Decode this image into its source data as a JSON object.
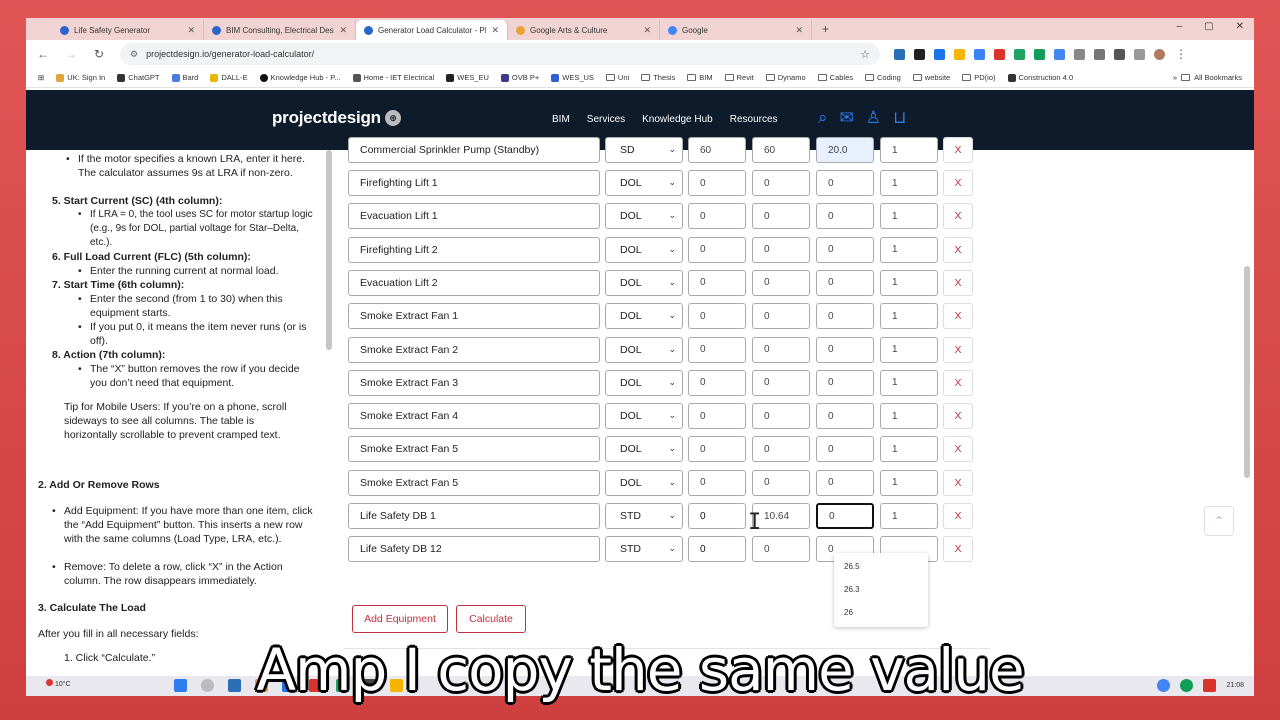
{
  "browser": {
    "tabs": [
      {
        "label": "Life Safety Generator",
        "active": false
      },
      {
        "label": "BIM Consulting, Electrical Des",
        "active": false
      },
      {
        "label": "Generator Load Calculator - PL",
        "active": true
      },
      {
        "label": "Google Arts & Culture",
        "active": false
      },
      {
        "label": "Google",
        "active": false
      }
    ],
    "new_tab": "+",
    "window_controls": [
      "–",
      "▢",
      "✕"
    ],
    "url": "projectdesign.io/generator-load-calculator/",
    "bookmarks": [
      "UK: Sign In",
      "ChatGPT",
      "Bard",
      "DALL-E",
      "Knowledge Hub - P...",
      "Home - IET Electrical",
      "WES_EU",
      "OVB P+",
      "WES_US",
      "Uni",
      "Thesis",
      "BIM",
      "Revit",
      "Dynamo",
      "Cables",
      "Coding",
      "website",
      "PD(io)",
      "Construction 4.0"
    ],
    "all_bookmarks": "All Bookmarks"
  },
  "site": {
    "logo": "projectdesign",
    "nav": [
      "BIM",
      "Services",
      "Knowledge Hub",
      "Resources"
    ],
    "icons": [
      "search-icon",
      "mail-icon",
      "user-icon",
      "cart-icon"
    ]
  },
  "left_panel": {
    "b1": "If the motor specifies a known LRA, enter it here. The calculator assumes 9s at LRA if non-zero.",
    "h5": "5. Start Current (SC) (4th column):",
    "b5": "If LRA = 0, the tool uses SC for motor startup logic (e.g., 9s for DOL, partial voltage for Star–Delta, etc.).",
    "h6": "6. Full Load Current (FLC) (5th column):",
    "b6": "Enter the running current at normal load.",
    "h7": "7. Start Time (6th column):",
    "b7a": "Enter the second (from 1 to 30) when this equipment starts.",
    "b7b": "If you put 0, it means the item never runs (or is off).",
    "h8": "8. Action (7th column):",
    "b8": "The “X” button removes the row if you decide you don’t need that equipment.",
    "tip": "Tip for Mobile Users: If you’re on a phone, scroll sideways to see all columns. The table is horizontally scrollable to prevent cramped text.",
    "h_add": "2. Add Or Remove Rows",
    "b_add": "Add Equipment: If you have more than one item, click the “Add Equipment” button. This inserts a new row with the same columns (Load Type, LRA, etc.).",
    "b_remove": "Remove: To delete a row, click “X” in the Action column. The row disappears immediately.",
    "h_calc": "3. Calculate The Load",
    "b_calc": "After you fill in all necessary fields:",
    "step1": "1. Click “Calculate.”"
  },
  "table": {
    "partial_row": {
      "name": "Commercial Sprinkler Pump (Standby)",
      "type": "SD",
      "lra": "60",
      "sc": "60",
      "flc": "20.0",
      "start": "1"
    },
    "rows": [
      {
        "name": "Firefighting Lift 1",
        "type": "DOL",
        "lra": "0",
        "sc": "0",
        "flc": "0",
        "start": "1"
      },
      {
        "name": "Evacuation Lift 1",
        "type": "DOL",
        "lra": "0",
        "sc": "0",
        "flc": "0",
        "start": "1"
      },
      {
        "name": "Firefighting Lift 2",
        "type": "DOL",
        "lra": "0",
        "sc": "0",
        "flc": "0",
        "start": "1"
      },
      {
        "name": "Evacuation Lift 2",
        "type": "DOL",
        "lra": "0",
        "sc": "0",
        "flc": "0",
        "start": "1"
      },
      {
        "name": "Smoke Extract Fan 1",
        "type": "DOL",
        "lra": "0",
        "sc": "0",
        "flc": "0",
        "start": "1"
      },
      {
        "name": "Smoke Extract Fan 2",
        "type": "DOL",
        "lra": "0",
        "sc": "0",
        "flc": "0",
        "start": "1"
      },
      {
        "name": "Smoke Extract Fan 3",
        "type": "DOL",
        "lra": "0",
        "sc": "0",
        "flc": "0",
        "start": "1"
      },
      {
        "name": "Smoke Extract Fan 4",
        "type": "DOL",
        "lra": "0",
        "sc": "0",
        "flc": "0",
        "start": "1"
      },
      {
        "name": "Smoke Extract Fan 5",
        "type": "DOL",
        "lra": "0",
        "sc": "0",
        "flc": "0",
        "start": "1"
      },
      {
        "name": "Smoke Extract Fan 5",
        "type": "DOL",
        "lra": "0",
        "sc": "0",
        "flc": "0",
        "start": "1"
      },
      {
        "name": "Life Safety DB 1",
        "type": "STD",
        "lra": "0",
        "sc": "10.64",
        "flc": "0",
        "start": "1"
      },
      {
        "name": "Life Safety DB 12",
        "type": "STD",
        "lra": "0",
        "sc": "0",
        "flc": "0",
        "start": ""
      }
    ],
    "remove_label": "X",
    "autocomplete": [
      "26.5",
      "26.3",
      "26"
    ],
    "add_button": "Add Equipment",
    "calculate_button": "Calculate"
  },
  "taskbar": {
    "weather": "10°C",
    "time": "21:08"
  },
  "caption": "Amp I copy the same value",
  "colors": {
    "frame": "#d84a4a",
    "header": "#0d1b2a",
    "accent": "#2f7bf0",
    "danger": "#c03040"
  }
}
